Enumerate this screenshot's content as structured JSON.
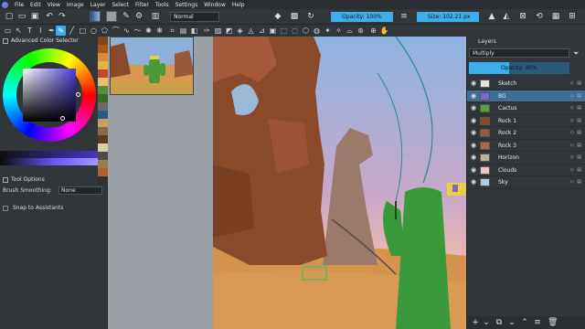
{
  "menu": [
    "File",
    "Edit",
    "View",
    "Image",
    "Layer",
    "Select",
    "Filter",
    "Tools",
    "Settings",
    "Window",
    "Help"
  ],
  "toolbar": {
    "blend_mode": "Normal",
    "opacity_label": "Opacity: 100%",
    "size_label": "Size: 102.21 px"
  },
  "left_dock": {
    "color_selector_title": "Advanced Color Selector",
    "tool_options_title": "Tool Options",
    "brush_smoothing_label": "Brush Smoothing:",
    "brush_smoothing_value": "None",
    "snap_label": "Snap to Assistants"
  },
  "palette_colors": [
    "#7a4a1a",
    "#a65a1a",
    "#d98b3a",
    "#e6b34a",
    "#c24a2a",
    "#e8c070",
    "#5a8a3a",
    "#3a6a2a",
    "#6a6a6a",
    "#2a5a8a",
    "#c8a060",
    "#8a6a40",
    "#5a3a20",
    "#d9d0a0",
    "#4a4a4a",
    "#9a7a50",
    "#b06030",
    "#303030"
  ],
  "layers_panel": {
    "title": "Layers",
    "blend_mode": "Multiply",
    "opacity_label": "Opacity: 40%",
    "opacity_value": 40,
    "layers": [
      {
        "name": "Sketch",
        "selected": false,
        "thumb": "#e8e0d8"
      },
      {
        "name": "BG",
        "selected": true,
        "thumb": "#7a6ad0"
      },
      {
        "name": "Cactus",
        "selected": false,
        "thumb": "#5aa040"
      },
      {
        "name": "Rock 1",
        "selected": false,
        "thumb": "#8a4a2a"
      },
      {
        "name": "Rock 2",
        "selected": false,
        "thumb": "#9a5a3a"
      },
      {
        "name": "Rock 3",
        "selected": false,
        "thumb": "#a66a4a"
      },
      {
        "name": "Horizon",
        "selected": false,
        "thumb": "#c0b0a0"
      },
      {
        "name": "Clouds",
        "selected": false,
        "thumb": "#e8c8c0"
      },
      {
        "name": "Sky",
        "selected": false,
        "thumb": "#b0c8e0"
      }
    ]
  },
  "colors": {
    "accent": "#3daee9",
    "panel": "#31363b",
    "selected_layer": "#3d6f96",
    "foreground_color": "#4b3bd6"
  }
}
